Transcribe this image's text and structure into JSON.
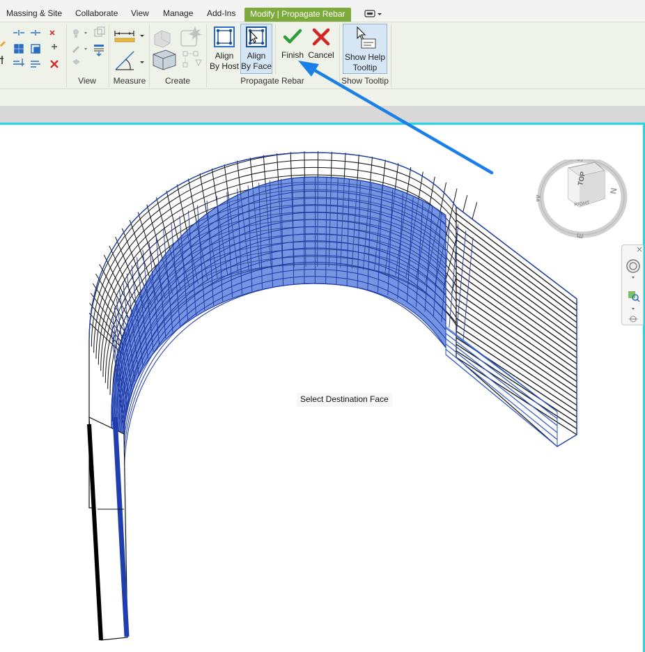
{
  "tabs": [
    "Massing & Site",
    "Collaborate",
    "View",
    "Manage",
    "Add-Ins",
    "Modify | Propagate Rebar"
  ],
  "ribbon": {
    "panels": {
      "view": "View",
      "measure": "Measure",
      "create": "Create",
      "propagate": "Propagate Rebar",
      "tooltip": "Show Tooltip"
    },
    "buttons": {
      "align_host": [
        "Align",
        "By Host"
      ],
      "align_face": [
        "Align",
        "By Face"
      ],
      "finish": "Finish",
      "cancel": "Cancel",
      "show_help": [
        "Show Help",
        "Tooltip"
      ]
    }
  },
  "viewport": {
    "prompt": "Select Destination Face",
    "viewcube": {
      "top": "TOP",
      "right": "RIGHT",
      "compass": [
        "S",
        "N",
        "W",
        "E"
      ]
    }
  },
  "colors": {
    "accent_tab": "#7cab3b",
    "viewport_border": "#21d7e6",
    "selection_blue": "#2a55c8",
    "arrow": "#1a7fe6"
  }
}
